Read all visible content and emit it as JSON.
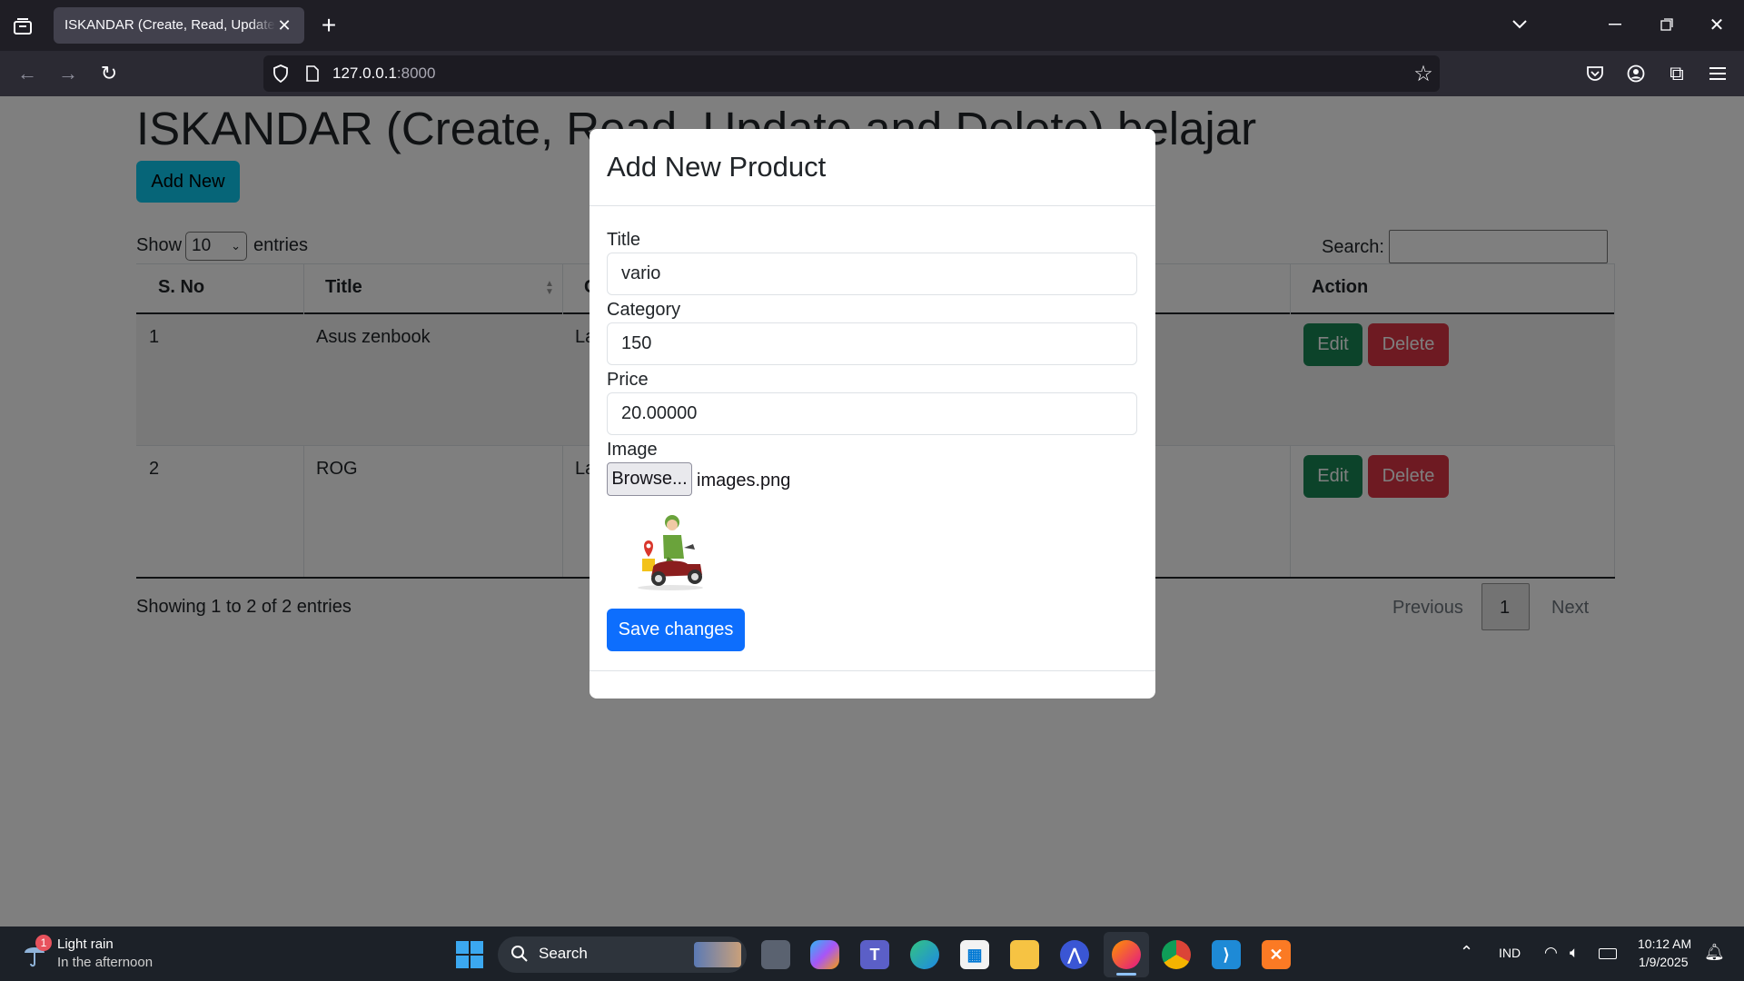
{
  "browser": {
    "tab_title": "ISKANDAR (Create, Read, Update and Delete) belajar",
    "url_host": "127.0.0.1",
    "url_port": ":8000"
  },
  "page": {
    "heading": "ISKANDAR (Create, Read, Update and Delete) belajar",
    "add_new_label": "Add New",
    "show_label": "Show",
    "entries_value": "10",
    "entries_label": "entries",
    "search_label": "Search:",
    "table": {
      "headers": [
        "S. No",
        "Title",
        "C",
        "Action"
      ],
      "rows": [
        {
          "sno": "1",
          "title": "Asus zenbook",
          "category": "La"
        },
        {
          "sno": "2",
          "title": "ROG",
          "category": "La"
        }
      ],
      "edit_label": "Edit",
      "delete_label": "Delete"
    },
    "info": "Showing 1 to 2 of 2 entries",
    "pagination": {
      "previous": "Previous",
      "current": "1",
      "next": "Next"
    }
  },
  "modal": {
    "title": "Add New Product",
    "fields": {
      "title_label": "Title",
      "title_value": "vario",
      "category_label": "Category",
      "category_value": "150",
      "price_label": "Price",
      "price_value": "20.00000",
      "image_label": "Image",
      "browse_label": "Browse...",
      "file_name": "images.png"
    },
    "save_label": "Save changes"
  },
  "taskbar": {
    "weather_title": "Light rain",
    "weather_sub": "In the afternoon",
    "weather_badge": "1",
    "search_label": "Search",
    "lang": "IND",
    "time": "10:12 AM",
    "date": "1/9/2025"
  },
  "colors": {
    "primary": "#0d6efd",
    "info": "#0dcaf0",
    "success": "#198754",
    "danger": "#dc3545"
  }
}
